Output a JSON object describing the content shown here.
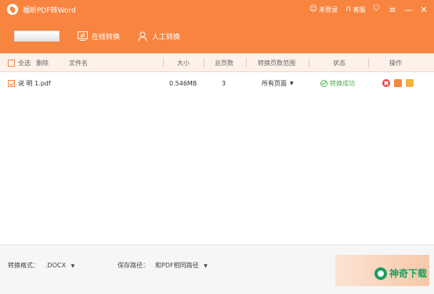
{
  "window": {
    "title": "福昕PDF转Word",
    "login_label": "未登录",
    "service_label": "客服",
    "minimize_glyph": "—",
    "menu_glyph": "≡",
    "close_glyph": "✕",
    "accent_color": "#f8853f"
  },
  "toolbar": {
    "online_convert_label": "在线转换",
    "manual_convert_label": "人工转换"
  },
  "table": {
    "select_all_label": "全选",
    "delete_label": "删除",
    "columns": {
      "filename": "文件名",
      "size": "大小",
      "pages": "总页数",
      "range": "转换页数范围",
      "status": "状态",
      "actions": "操作"
    },
    "rows": [
      {
        "filename": "说 明 1.pdf",
        "size": "0.546MB",
        "pages": "3",
        "range": "所有页面",
        "status": "转换成功"
      }
    ]
  },
  "bottom": {
    "format_label": "转换格式：",
    "format_value": ".DOCX",
    "path_label": "保存路径：",
    "path_value": "和PDF相同路径"
  },
  "watermark": {
    "text": "神奇下载"
  }
}
